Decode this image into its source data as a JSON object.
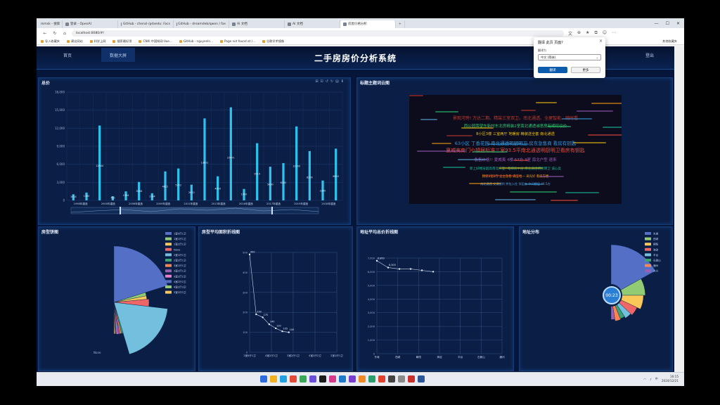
{
  "browser": {
    "tabs": [
      {
        "label": "mmsk - 搜索",
        "active": false
      },
      {
        "label": "登录 - OpenAI",
        "active": false
      },
      {
        "label": "GitHub - chensl-/pdxedu: Facs",
        "active": false
      },
      {
        "label": "GitHub - dreamdeb/qwen / fas",
        "active": false
      },
      {
        "label": "AI 文档",
        "active": false
      },
      {
        "label": "AI 文档",
        "active": false
      },
      {
        "label": "房屋价格分析",
        "active": true
      }
    ],
    "new_tab": "+",
    "address": "localhost:8080/#/",
    "bookmarks": [
      "导入收藏夹",
      "建议网站",
      "科学上网",
      "搜索最好用",
      "CNKI 中国知网-Vue...",
      "GitHub - nguyenln...",
      "Page not found at /...",
      "谷歌学术镜像"
    ],
    "bookmarks_right": "其他收藏夹"
  },
  "header": {
    "title": "二手房房价分析系统",
    "nav_left": [
      "首页",
      "数据大屏"
    ],
    "nav_right": "登出"
  },
  "dialog": {
    "title": "翻译 此页 页面?",
    "close": "×",
    "label": "翻译为",
    "select_value": "中文 (简体)",
    "primary": "翻译",
    "secondary": "更多"
  },
  "panels": {
    "total_price": "总价",
    "wordcloud": "标题主题词云图",
    "house_type_pie": "房型饼图",
    "area_trend": "房型平均面积折线图",
    "address_price": "地址平均总价折线图",
    "address_dist": "地址分布"
  },
  "chart_data": [
    {
      "type": "bar",
      "title": "总价",
      "ylim": [
        0,
        18000
      ],
      "yticks": [
        "0",
        "3,000",
        "6,000",
        "9,000",
        "12,000",
        "15,000",
        "18,000"
      ],
      "xticks": [
        "1998年建造",
        "2000年建造",
        "2006年建造",
        "2009年建造",
        "2011年建造",
        "2013年建造",
        "2016年建造",
        "2017年建造",
        "2019年建造",
        "2018年建造"
      ],
      "values": [
        1014,
        1300,
        12444,
        700,
        1504,
        3068,
        1184,
        4822,
        5302,
        2610,
        13631,
        4000,
        15471,
        1900,
        9510,
        5600,
        6200,
        12300,
        8200,
        3300,
        8600
      ],
      "value_labels": [
        "1014",
        "1300",
        "12444",
        "700",
        "1504",
        "3068",
        "1184",
        "4822",
        "5302",
        "2610",
        "13631",
        "4000",
        "15471",
        "1900",
        "9510",
        "5600",
        "6200",
        "12300",
        "8200",
        "3300",
        "8600"
      ],
      "color": "#2ec3ee"
    },
    {
      "type": "pie",
      "title": "房型饼图",
      "legend": [
        "1室0厅1卫",
        "1室1厅1卫",
        "1室2厅1卫",
        "None",
        "2室1厅1卫",
        "2室2厅1卫",
        "3室1厅1卫",
        "3室2厅1卫",
        "3室2厅2卫",
        "4室2厅2卫",
        "4室2厅3卫",
        "5室2厅2卫"
      ],
      "colors": [
        "#5470c6",
        "#91cc75",
        "#fac858",
        "#ee6666",
        "#73c0de",
        "#3ba272",
        "#fc8452",
        "#9a60b4",
        "#ea7ccc",
        "#5470c6",
        "#91cc75",
        "#fac858"
      ],
      "values": [
        24,
        2,
        2,
        4,
        22,
        1,
        1,
        1,
        1,
        0.5,
        0.5,
        0.5
      ],
      "outer_label": "None"
    },
    {
      "type": "line",
      "title": "房型平均面积折线图",
      "x": [
        "1室0厅1卫",
        "4室2厅2卫",
        "3室2厅1卫",
        "4室2厅2卫",
        "2室1厅1卫"
      ],
      "ylim": [
        0,
        500
      ],
      "yticks": [
        "0",
        "100",
        "200",
        "300",
        "400",
        "500"
      ],
      "values": [
        490,
        190,
        175,
        140,
        120,
        105,
        100
      ],
      "point_labels": [
        "490",
        "190",
        "175",
        "140",
        "120",
        "105",
        "100"
      ]
    },
    {
      "type": "line",
      "title": "地址平均总价折线图",
      "x": [
        "东城",
        "西城",
        "朝阳",
        "海淀",
        "丰台",
        "石景山",
        "通州"
      ],
      "ylim": [
        0,
        7000
      ],
      "yticks": [
        "0",
        "1,000",
        "2,000",
        "3,000",
        "4,000",
        "5,000",
        "6,000",
        "7,000"
      ],
      "values": [
        6800,
        6300,
        6200,
        6200,
        6100,
        6000
      ],
      "point_labels": [
        "6,800",
        "6,300"
      ]
    },
    {
      "type": "pie",
      "title": "地址分布",
      "legend": [
        "东城",
        "西城",
        "朝阳",
        "海淀",
        "丰台",
        "石景山",
        "通州",
        "大兴"
      ],
      "colors": [
        "#5470c6",
        "#91cc75",
        "#fac858",
        "#ee6666",
        "#73c0de",
        "#3ba272",
        "#fc8452",
        "#9a60b4"
      ],
      "values": [
        34,
        16,
        14,
        10,
        8,
        6,
        7,
        5
      ]
    }
  ],
  "wordcloud": {
    "lines": [
      "景观河旁! 万达二期。精装三室双卫。南北通透。全屋智能。随时看",
      "西公园旁望东新村东北房精装2室南北通透诚意房有明可议价",
      "8小区3楼 三室两厅 地暖房 精装送全套 南北通透",
      "63小区 丁香花园 南北通透明厨明卫 房东急售商 看房有钥匙",
      "夏威夷南门小镇居标准三室93.5平南北通透明厨明卫看房有钥匙",
      "急售价格!! 夏威夷 4楼 57方 3室 南北户型 速来",
      "新上好楼层超高南北三室! 电梯房中层 南北通透明厨明卫 诚心卖",
      "精装3室2厅 业主急售 满五唯一 采光好 看房方便",
      "南北通透 交通便利 拎包入住 学区房 中间楼层 44.5方"
    ]
  },
  "timer": "00:23",
  "taskbar": {
    "clock_time": "16:15",
    "clock_date": "2024/12/21",
    "lang": "中"
  }
}
